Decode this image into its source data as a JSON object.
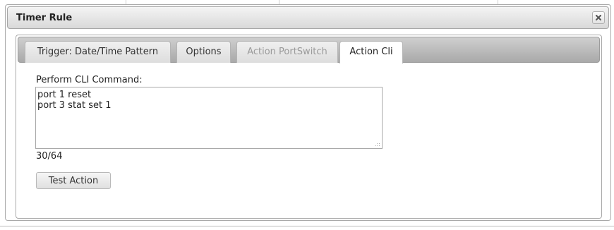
{
  "dialog": {
    "title": "Timer Rule",
    "close_icon": "close-x-icon"
  },
  "tabs": [
    {
      "label": "Trigger: Date/Time Pattern",
      "state": "normal"
    },
    {
      "label": "Options",
      "state": "normal"
    },
    {
      "label": "Action PortSwitch",
      "state": "disabled"
    },
    {
      "label": "Action Cli",
      "state": "active"
    }
  ],
  "cli": {
    "label": "Perform CLI Command:",
    "value": "port 1 reset\nport 3 stat set 1",
    "counter": "30/64"
  },
  "buttons": {
    "test_action": "Test Action"
  }
}
